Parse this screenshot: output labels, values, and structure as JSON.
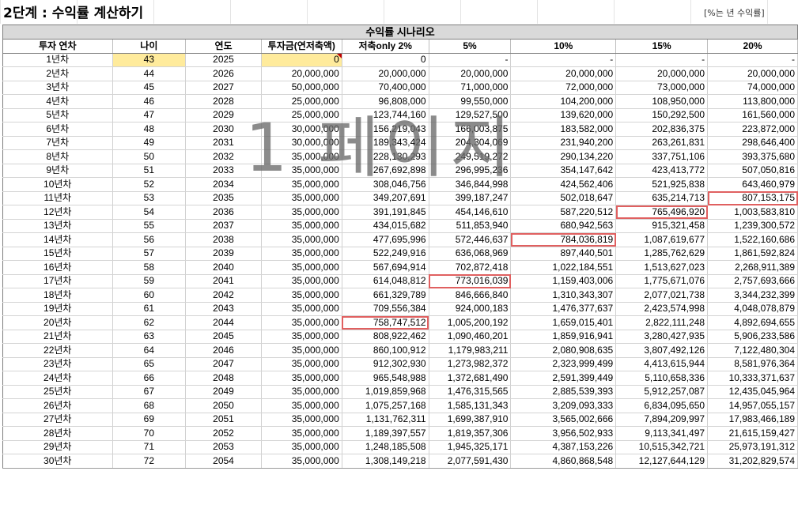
{
  "title": "2단계 : 수익률 계산하기",
  "note": "[%는 년 수익률]",
  "watermark": "1 페이지",
  "scenario_banner": "수익률 시나리오",
  "headers": [
    "투자 연차",
    "나이",
    "연도",
    "투자금(연저축액)",
    "저축only 2%",
    "5%",
    "10%",
    "15%",
    "20%"
  ],
  "rows": [
    [
      "1년차",
      "43",
      "2025",
      "0",
      "0",
      "-",
      "-",
      "-",
      "-"
    ],
    [
      "2년차",
      "44",
      "2026",
      "20,000,000",
      "20,000,000",
      "20,000,000",
      "20,000,000",
      "20,000,000",
      "20,000,000"
    ],
    [
      "3년차",
      "45",
      "2027",
      "50,000,000",
      "70,400,000",
      "71,000,000",
      "72,000,000",
      "73,000,000",
      "74,000,000"
    ],
    [
      "4년차",
      "46",
      "2028",
      "25,000,000",
      "96,808,000",
      "99,550,000",
      "104,200,000",
      "108,950,000",
      "113,800,000"
    ],
    [
      "5년차",
      "47",
      "2029",
      "25,000,000",
      "123,744,160",
      "129,527,500",
      "139,620,000",
      "150,292,500",
      "161,560,000"
    ],
    [
      "6년차",
      "48",
      "2030",
      "30,000,000",
      "156,219,043",
      "166,003,875",
      "183,582,000",
      "202,836,375",
      "223,872,000"
    ],
    [
      "7년차",
      "49",
      "2031",
      "30,000,000",
      "189,343,424",
      "204,304,069",
      "231,940,200",
      "263,261,831",
      "298,646,400"
    ],
    [
      "8년차",
      "50",
      "2032",
      "35,000,000",
      "228,130,293",
      "249,519,272",
      "290,134,220",
      "337,751,106",
      "393,375,680"
    ],
    [
      "9년차",
      "51",
      "2033",
      "35,000,000",
      "267,692,898",
      "296,995,236",
      "354,147,642",
      "423,413,772",
      "507,050,816"
    ],
    [
      "10년차",
      "52",
      "2034",
      "35,000,000",
      "308,046,756",
      "346,844,998",
      "424,562,406",
      "521,925,838",
      "643,460,979"
    ],
    [
      "11년차",
      "53",
      "2035",
      "35,000,000",
      "349,207,691",
      "399,187,247",
      "502,018,647",
      "635,214,713",
      "807,153,175"
    ],
    [
      "12년차",
      "54",
      "2036",
      "35,000,000",
      "391,191,845",
      "454,146,610",
      "587,220,512",
      "765,496,920",
      "1,003,583,810"
    ],
    [
      "13년차",
      "55",
      "2037",
      "35,000,000",
      "434,015,682",
      "511,853,940",
      "680,942,563",
      "915,321,458",
      "1,239,300,572"
    ],
    [
      "14년차",
      "56",
      "2038",
      "35,000,000",
      "477,695,996",
      "572,446,637",
      "784,036,819",
      "1,087,619,677",
      "1,522,160,686"
    ],
    [
      "15년차",
      "57",
      "2039",
      "35,000,000",
      "522,249,916",
      "636,068,969",
      "897,440,501",
      "1,285,762,629",
      "1,861,592,824"
    ],
    [
      "16년차",
      "58",
      "2040",
      "35,000,000",
      "567,694,914",
      "702,872,418",
      "1,022,184,551",
      "1,513,627,023",
      "2,268,911,389"
    ],
    [
      "17년차",
      "59",
      "2041",
      "35,000,000",
      "614,048,812",
      "773,016,039",
      "1,159,403,006",
      "1,775,671,076",
      "2,757,693,666"
    ],
    [
      "18년차",
      "60",
      "2042",
      "35,000,000",
      "661,329,789",
      "846,666,840",
      "1,310,343,307",
      "2,077,021,738",
      "3,344,232,399"
    ],
    [
      "19년차",
      "61",
      "2043",
      "35,000,000",
      "709,556,384",
      "924,000,183",
      "1,476,377,637",
      "2,423,574,998",
      "4,048,078,879"
    ],
    [
      "20년차",
      "62",
      "2044",
      "35,000,000",
      "758,747,512",
      "1,005,200,192",
      "1,659,015,401",
      "2,822,111,248",
      "4,892,694,655"
    ],
    [
      "21년차",
      "63",
      "2045",
      "35,000,000",
      "808,922,462",
      "1,090,460,201",
      "1,859,916,941",
      "3,280,427,935",
      "5,906,233,586"
    ],
    [
      "22년차",
      "64",
      "2046",
      "35,000,000",
      "860,100,912",
      "1,179,983,211",
      "2,080,908,635",
      "3,807,492,126",
      "7,122,480,304"
    ],
    [
      "23년차",
      "65",
      "2047",
      "35,000,000",
      "912,302,930",
      "1,273,982,372",
      "2,323,999,499",
      "4,413,615,944",
      "8,581,976,364"
    ],
    [
      "24년차",
      "66",
      "2048",
      "35,000,000",
      "965,548,988",
      "1,372,681,490",
      "2,591,399,449",
      "5,110,658,336",
      "10,333,371,637"
    ],
    [
      "25년차",
      "67",
      "2049",
      "35,000,000",
      "1,019,859,968",
      "1,476,315,565",
      "2,885,539,393",
      "5,912,257,087",
      "12,435,045,964"
    ],
    [
      "26년차",
      "68",
      "2050",
      "35,000,000",
      "1,075,257,168",
      "1,585,131,343",
      "3,209,093,333",
      "6,834,095,650",
      "14,957,055,157"
    ],
    [
      "27년차",
      "69",
      "2051",
      "35,000,000",
      "1,131,762,311",
      "1,699,387,910",
      "3,565,002,666",
      "7,894,209,997",
      "17,983,466,189"
    ],
    [
      "28년차",
      "70",
      "2052",
      "35,000,000",
      "1,189,397,557",
      "1,819,357,306",
      "3,956,502,933",
      "9,113,341,497",
      "21,615,159,427"
    ],
    [
      "29년차",
      "71",
      "2053",
      "35,000,000",
      "1,248,185,508",
      "1,945,325,171",
      "4,387,153,226",
      "10,515,342,721",
      "25,973,191,312"
    ],
    [
      "30년차",
      "72",
      "2054",
      "35,000,000",
      "1,308,149,218",
      "2,077,591,430",
      "4,860,868,548",
      "12,127,644,129",
      "31,202,829,574"
    ]
  ],
  "highlighted_cells": [
    {
      "row": 10,
      "col": 8
    },
    {
      "row": 11,
      "col": 7
    },
    {
      "row": 13,
      "col": 6
    },
    {
      "row": 16,
      "col": 5
    },
    {
      "row": 19,
      "col": 4
    }
  ],
  "input_cells": [
    {
      "row": 0,
      "col": 1
    },
    {
      "row": 0,
      "col": 3
    }
  ],
  "colors": {
    "input_fill": "#ffeb9c",
    "highlight_border": "#e06060",
    "banner_fill": "#d9d9d9"
  }
}
